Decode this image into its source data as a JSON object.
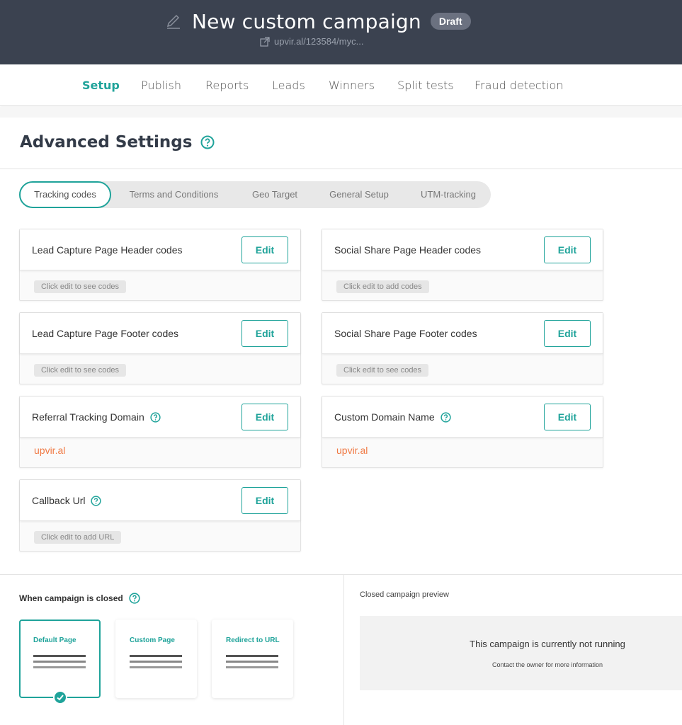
{
  "header": {
    "title": "New custom campaign",
    "status_badge": "Draft",
    "url": "upvir.al/123584/myc..."
  },
  "nav": {
    "items": [
      "Setup",
      "Publish",
      "Reports",
      "Leads",
      "Winners",
      "Split tests",
      "Fraud detection"
    ],
    "active": "Setup"
  },
  "page": {
    "heading": "Advanced Settings"
  },
  "tabs": {
    "items": [
      "Tracking codes",
      "Terms and Conditions",
      "Geo Target",
      "General Setup",
      "UTM-tracking"
    ],
    "active": "Tracking codes"
  },
  "cards": [
    {
      "title": "Lead Capture Page Header codes",
      "button": "Edit",
      "body": "Click edit to see codes",
      "help": false
    },
    {
      "title": "Social Share Page Header codes",
      "button": "Edit",
      "body": "Click edit to add codes",
      "help": false
    },
    {
      "title": "Lead Capture Page Footer codes",
      "button": "Edit",
      "body": "Click edit to see codes",
      "help": false
    },
    {
      "title": "Social Share Page Footer codes",
      "button": "Edit",
      "body": "Click edit to see codes",
      "help": false
    },
    {
      "title": "Referral Tracking Domain",
      "button": "Edit",
      "body": "upvir.al",
      "help": true
    },
    {
      "title": "Custom Domain Name",
      "button": "Edit",
      "body": "upvir.al",
      "help": true
    },
    {
      "title": "Callback Url",
      "button": "Edit",
      "body": "Click edit to add URL",
      "help": true
    }
  ],
  "closed": {
    "label": "When campaign is closed",
    "options": [
      "Default Page",
      "Custom Page",
      "Redirect to URL"
    ],
    "selected": "Default Page"
  },
  "preview": {
    "label": "Closed campaign preview",
    "title": "This campaign is currently not running",
    "subtitle": "Contact the owner for more information"
  },
  "colors": {
    "accent": "#1fa39a",
    "header_bg": "#3b4250",
    "domain_text": "#f07a45"
  },
  "icons": [
    "pencil-icon",
    "external-link-icon",
    "help-icon",
    "check-icon"
  ]
}
